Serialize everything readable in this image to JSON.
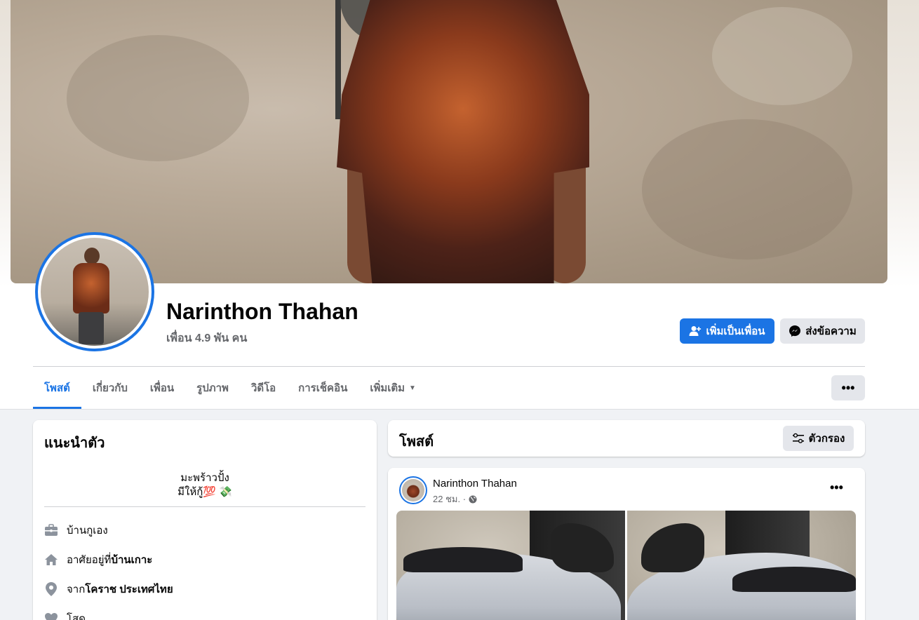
{
  "profile": {
    "name": "Narinthon Thahan",
    "friends": "เพื่อน 4.9 พัน คน"
  },
  "actions": {
    "add_friend": "เพิ่มเป็นเพื่อน",
    "message": "ส่งข้อความ",
    "more": "•••"
  },
  "tabs": [
    {
      "label": "โพสต์",
      "active": true
    },
    {
      "label": "เกี่ยวกับ"
    },
    {
      "label": "เพื่อน"
    },
    {
      "label": "รูปภาพ"
    },
    {
      "label": "วิดีโอ"
    },
    {
      "label": "การเช็คอิน"
    },
    {
      "label": "เพิ่มเติม",
      "caret": "▼"
    }
  ],
  "intro": {
    "title": "แนะนำตัว",
    "bio_line1": "มะพร้าวปั้ง",
    "bio_line2": "มีให้กู้💯 💸",
    "items": [
      {
        "icon": "briefcase-icon",
        "text": "บ้านกูเอง",
        "bold": ""
      },
      {
        "icon": "home-icon",
        "text": "อาศัยอยู่ที่ ",
        "bold": "บ้านเกาะ"
      },
      {
        "icon": "location-pin-icon",
        "text": "จาก ",
        "bold": "โคราช ประเทศไทย"
      },
      {
        "icon": "heart-icon",
        "text": "โสด",
        "bold": ""
      }
    ]
  },
  "posts": {
    "title": "โพสต์",
    "filter_label": "ตัวกรอง"
  },
  "post": {
    "author": "Narinthon Thahan",
    "time": "22 ชม. ·",
    "more": "•••"
  },
  "colors": {
    "accent": "#1b74e4",
    "secondary_button": "#e4e6eb",
    "page_bg": "#f0f2f5"
  }
}
